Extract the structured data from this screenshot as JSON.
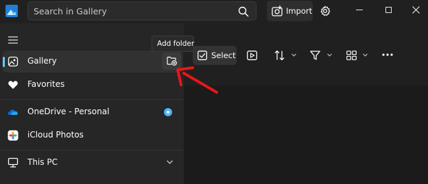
{
  "titlebar": {
    "app_icon": "photos-app-icon",
    "search_placeholder": "Search in Gallery",
    "search_icon": "search-icon",
    "import_label": "Import",
    "import_icon": "import-icon",
    "settings_icon": "gear-icon",
    "window_controls": [
      "minimize-icon",
      "maximize-icon",
      "close-icon"
    ]
  },
  "sidebar": {
    "menu_icon": "hamburger-icon",
    "items": [
      {
        "label": "Gallery",
        "icon": "gallery-icon",
        "selected": true
      },
      {
        "label": "Favorites",
        "icon": "heart-icon",
        "selected": false
      },
      {
        "label": "OneDrive - Personal",
        "icon": "onedrive-icon",
        "selected": false
      },
      {
        "label": "iCloud Photos",
        "icon": "icloud-photos-icon",
        "selected": false
      },
      {
        "label": "This PC",
        "icon": "computer-icon",
        "selected": false
      }
    ],
    "add_folder_icon": "add-folder-icon"
  },
  "tooltip": {
    "text": "Add folder"
  },
  "toolbar": {
    "select_label": "Select",
    "select_icon": "checkbox-icon",
    "buttons": [
      "slideshow-icon",
      "sort-icon",
      "filter-icon",
      "view-layout-icon",
      "more-icon"
    ]
  },
  "colors": {
    "accent": "#60cdff",
    "sidebar_bg": "#262626",
    "toolbar_bg": "#202020",
    "annotation_arrow": "#e8161a"
  }
}
